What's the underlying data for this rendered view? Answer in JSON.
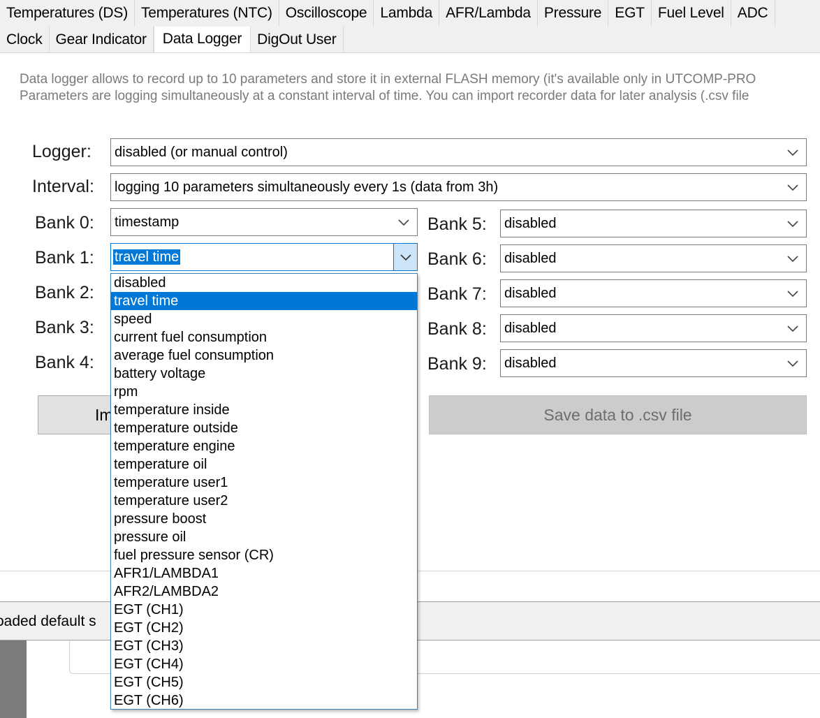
{
  "tabs_row1": [
    "Temperatures (DS)",
    "Temperatures (NTC)",
    "Oscilloscope",
    "Lambda",
    "AFR/Lambda",
    "Pressure",
    "EGT",
    "Fuel Level",
    "ADC"
  ],
  "tabs_row2": [
    "Clock",
    "Gear Indicator",
    "Data Logger",
    "DigOut User"
  ],
  "active_tab": "Data Logger",
  "description": {
    "line1": "Data logger allows to record up to 10 parameters and store it in external FLASH memory (it's available only in UTCOMP-PRO",
    "line2": "Parameters are logging simultaneously at a constant interval of time. You can import recorder data for later analysis (.csv file"
  },
  "logger": {
    "label": "Logger:",
    "value": "disabled (or manual control)"
  },
  "interval": {
    "label": "Interval:",
    "value": "logging 10 parameters simultaneously every 1s (data from 3h)"
  },
  "banks_left": [
    {
      "label": "Bank 0:",
      "value": "timestamp"
    },
    {
      "label": "Bank 1:",
      "value": "travel time"
    },
    {
      "label": "Bank 2:",
      "value": ""
    },
    {
      "label": "Bank 3:",
      "value": ""
    },
    {
      "label": "Bank 4:",
      "value": ""
    }
  ],
  "banks_right": [
    {
      "label": "Bank 5:",
      "value": "disabled"
    },
    {
      "label": "Bank 6:",
      "value": "disabled"
    },
    {
      "label": "Bank 7:",
      "value": "disabled"
    },
    {
      "label": "Bank 8:",
      "value": "disabled"
    },
    {
      "label": "Bank 9:",
      "value": "disabled"
    }
  ],
  "buttons": {
    "import_partial": "Im",
    "save_csv": "Save data to .csv file"
  },
  "status": {
    "text": "oaded default s"
  },
  "dropdown": {
    "selected": "travel time",
    "options": [
      "disabled",
      "travel time",
      "speed",
      "current fuel consumption",
      "average fuel consumption",
      "battery voltage",
      "rpm",
      "temperature inside",
      "temperature outside",
      "temperature engine",
      "temperature oil",
      "temperature user1",
      "temperature user2",
      "pressure boost",
      "pressure oil",
      "fuel pressure sensor (CR)",
      "AFR1/LAMBDA1",
      "AFR2/LAMBDA2",
      "EGT (CH1)",
      "EGT (CH2)",
      "EGT (CH3)",
      "EGT (CH4)",
      "EGT (CH5)",
      "EGT (CH6)"
    ]
  },
  "icons": {
    "combo_arrow": "chevron-down-icon"
  },
  "colors": {
    "accent": "#0078d7",
    "accent_light": "#cce4f7",
    "tab_bg": "#f0f0f0",
    "desc_text": "#7a7a7a"
  }
}
